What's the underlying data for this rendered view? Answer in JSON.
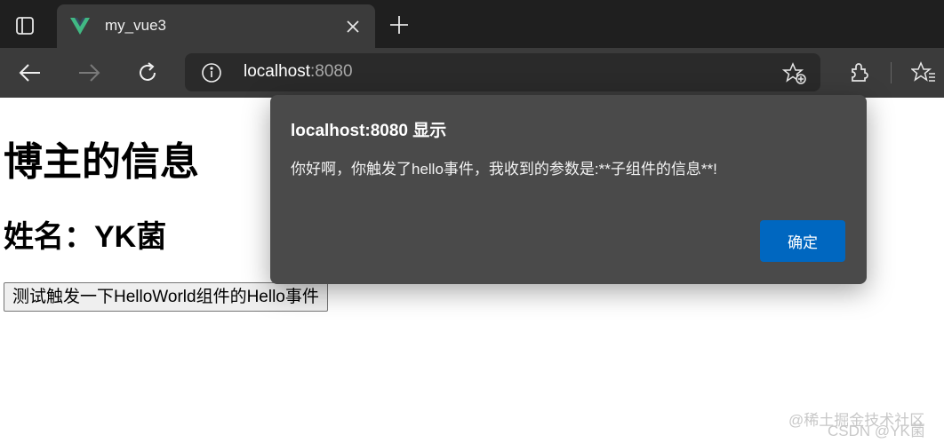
{
  "browser": {
    "tab_title": "my_vue3",
    "url_host": "localhost",
    "url_port": ":8080"
  },
  "page": {
    "heading": "博主的信息",
    "name_line": "姓名：YK菌",
    "button_label": "测试触发一下HelloWorld组件的Hello事件"
  },
  "alert": {
    "title": "localhost:8080 显示",
    "message": "你好啊，你触发了hello事件，我收到的参数是:**子组件的信息**!",
    "ok_label": "确定"
  },
  "watermarks": {
    "juejin": "@稀土掘金技术社区",
    "csdn": "CSDN @YK菌"
  },
  "colors": {
    "vue_logo": "#41b883",
    "ok_button": "#0067c0",
    "dialog_bg": "#4a4a4a",
    "tabstrip_bg": "#1f1f1f",
    "toolbar_bg": "#3b3b3b"
  }
}
